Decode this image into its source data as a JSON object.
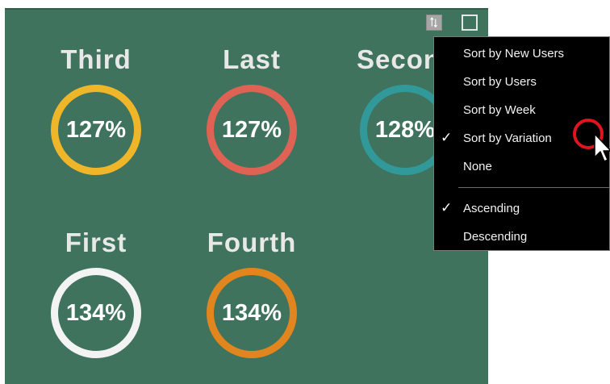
{
  "kpis": [
    {
      "title": "Third",
      "value": "127%",
      "ring_color": "#f0b62a"
    },
    {
      "title": "Last",
      "value": "127%",
      "ring_color": "#df6354"
    },
    {
      "title": "Second",
      "value": "128%",
      "ring_color": "#31999a"
    },
    {
      "title": "First",
      "value": "134%",
      "ring_color": "#f3f3f3"
    },
    {
      "title": "Fourth",
      "value": "134%",
      "ring_color": "#e1851e"
    }
  ],
  "header": {
    "sort_icon": "sort-arrows-icon",
    "focus_icon": "focus-mode-icon"
  },
  "sort_menu": {
    "items": [
      {
        "label": "Sort by New Users",
        "checked": false
      },
      {
        "label": "Sort by Users",
        "checked": false
      },
      {
        "label": "Sort by Week",
        "checked": false
      },
      {
        "label": "Sort by Variation",
        "checked": true
      },
      {
        "label": "None",
        "checked": false
      }
    ],
    "order": [
      {
        "label": "Ascending",
        "checked": true
      },
      {
        "label": "Descending",
        "checked": false
      }
    ],
    "check_glyph": "✓"
  },
  "colors": {
    "background": "#3f735d",
    "menu_background": "#000000",
    "highlight": "#e0141e"
  }
}
